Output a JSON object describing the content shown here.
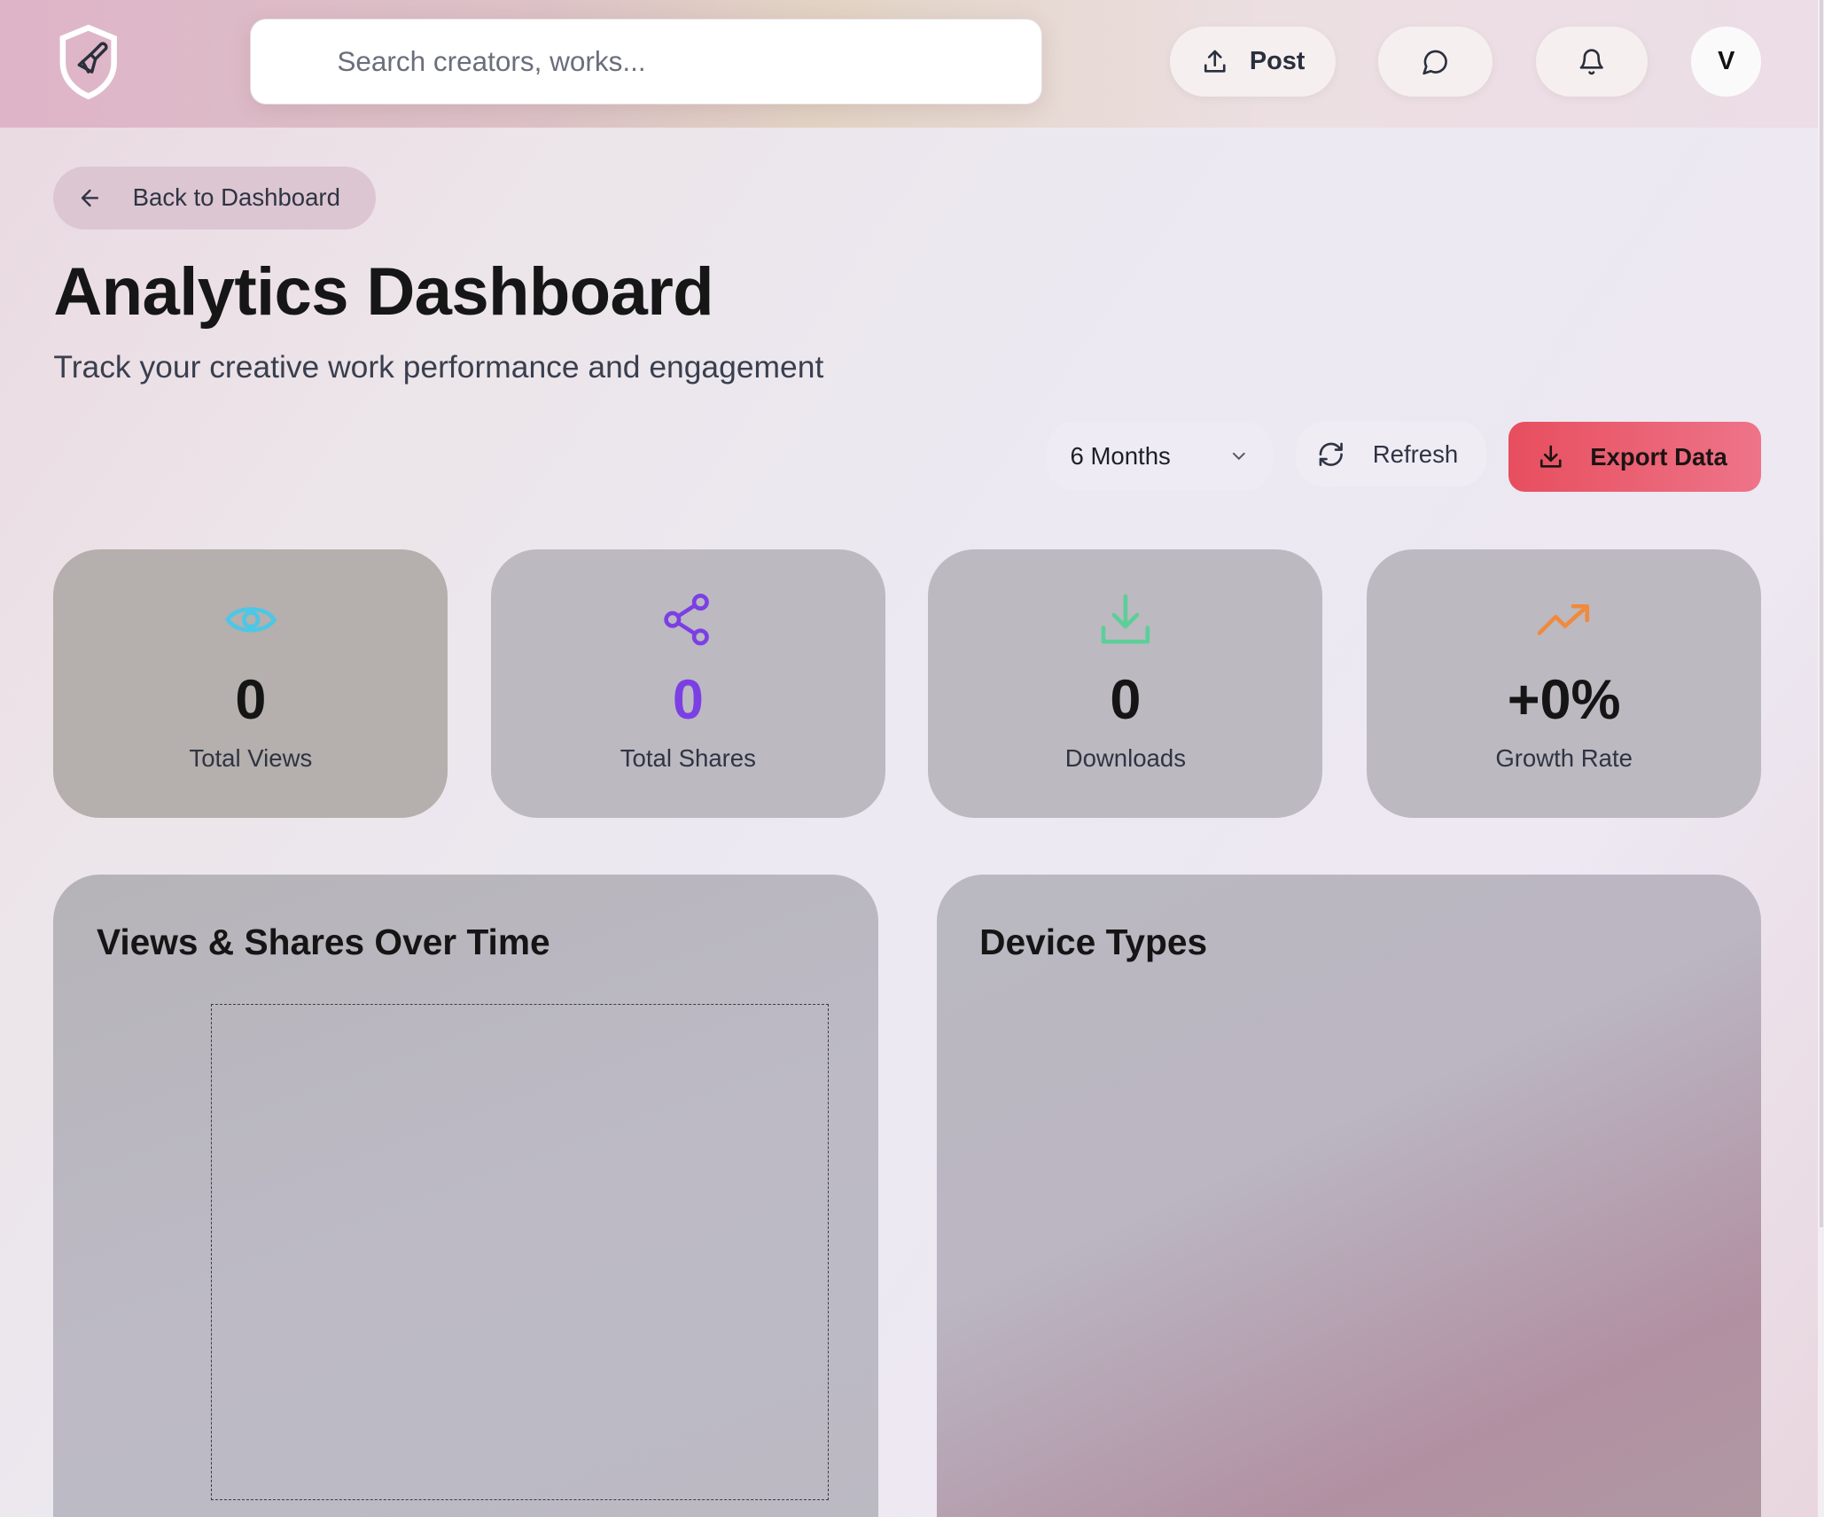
{
  "header": {
    "search_placeholder": "Search creators, works...",
    "post_label": "Post",
    "avatar_initial": "V"
  },
  "page": {
    "back_label": "Back to Dashboard",
    "title": "Analytics Dashboard",
    "subtitle": "Track your creative work performance and engagement"
  },
  "toolbar": {
    "range_selected": "6 Months",
    "refresh_label": "Refresh",
    "export_label": "Export Data"
  },
  "stats": [
    {
      "value": "0",
      "label": "Total Views",
      "icon": "eye-icon",
      "color": "#4cc7e6"
    },
    {
      "value": "0",
      "label": "Total Shares",
      "icon": "share-icon",
      "color": "#7b3fe4"
    },
    {
      "value": "0",
      "label": "Downloads",
      "icon": "download-icon",
      "color": "#5ccf98"
    },
    {
      "value": "+0%",
      "label": "Growth Rate",
      "icon": "trending-up-icon",
      "color": "#f08a3c"
    }
  ],
  "panels": {
    "views_shares_title": "Views & Shares Over Time",
    "device_types_title": "Device Types"
  },
  "colors": {
    "accent": "#e74e5e",
    "shares_value": "#7b3fe4"
  }
}
